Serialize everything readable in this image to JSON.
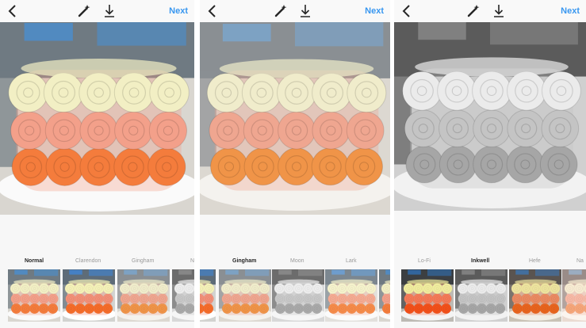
{
  "screens": [
    {
      "filters": [
        {
          "label": "Normal",
          "selected": true
        },
        {
          "label": "Clarendon",
          "selected": false
        },
        {
          "label": "Gingham",
          "selected": false
        },
        {
          "label": "N",
          "selected": false
        }
      ],
      "next_label": "Next"
    },
    {
      "filters": [
        {
          "label": "Gingham",
          "selected": true
        },
        {
          "label": "Moon",
          "selected": false
        },
        {
          "label": "Lark",
          "selected": false
        }
      ],
      "next_label": "Next"
    },
    {
      "filters": [
        {
          "label": "Lo-Fi",
          "selected": false
        },
        {
          "label": "Inkwell",
          "selected": true
        },
        {
          "label": "Hefe",
          "selected": false
        },
        {
          "label": "Na",
          "selected": false
        }
      ],
      "next_label": "Next"
    }
  ],
  "colors": {
    "accent": "#3897f0",
    "top_tier": "#f2efc4",
    "middle_tier": "#f3a08a",
    "bottom_tier": "#f47c3c"
  }
}
